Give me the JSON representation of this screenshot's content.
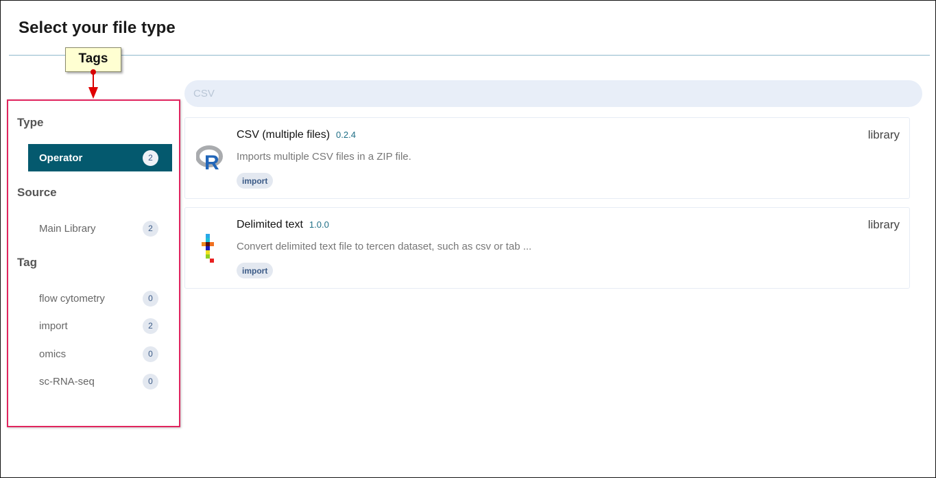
{
  "page": {
    "title": "Select your file type"
  },
  "callout": {
    "label": "Tags",
    "colors": {
      "box": "#ffffd2",
      "arrow": "#e00000",
      "highlight": "#e0245e"
    }
  },
  "sidebar": {
    "sections": [
      {
        "title": "Type",
        "items": [
          {
            "label": "Operator",
            "count": "2",
            "active": true
          }
        ]
      },
      {
        "title": "Source",
        "items": [
          {
            "label": "Main Library",
            "count": "2",
            "active": false
          }
        ]
      },
      {
        "title": "Tag",
        "items": [
          {
            "label": "flow cytometry",
            "count": "0",
            "active": false
          },
          {
            "label": "import",
            "count": "2",
            "active": false
          },
          {
            "label": "omics",
            "count": "0",
            "active": false
          },
          {
            "label": "sc-RNA-seq",
            "count": "0",
            "active": false
          }
        ]
      }
    ]
  },
  "search": {
    "value": "CSV",
    "placeholder": "CSV"
  },
  "results": [
    {
      "icon": "r-logo-icon",
      "title": "CSV (multiple files)",
      "version": "0.2.4",
      "description": "Imports multiple CSV files in a ZIP file.",
      "tag": "import",
      "source": "library"
    },
    {
      "icon": "tercen-logo-icon",
      "title": "Delimited text",
      "version": "1.0.0",
      "description": "Convert delimited text file to tercen dataset, such as csv or tab ...",
      "tag": "import",
      "source": "library"
    }
  ],
  "colors": {
    "accent": "#04596e",
    "version_text": "#1f6f86",
    "badge_bg": "#e3e8f0",
    "badge_text": "#3b5a86",
    "search_bg": "#e8eef8"
  }
}
